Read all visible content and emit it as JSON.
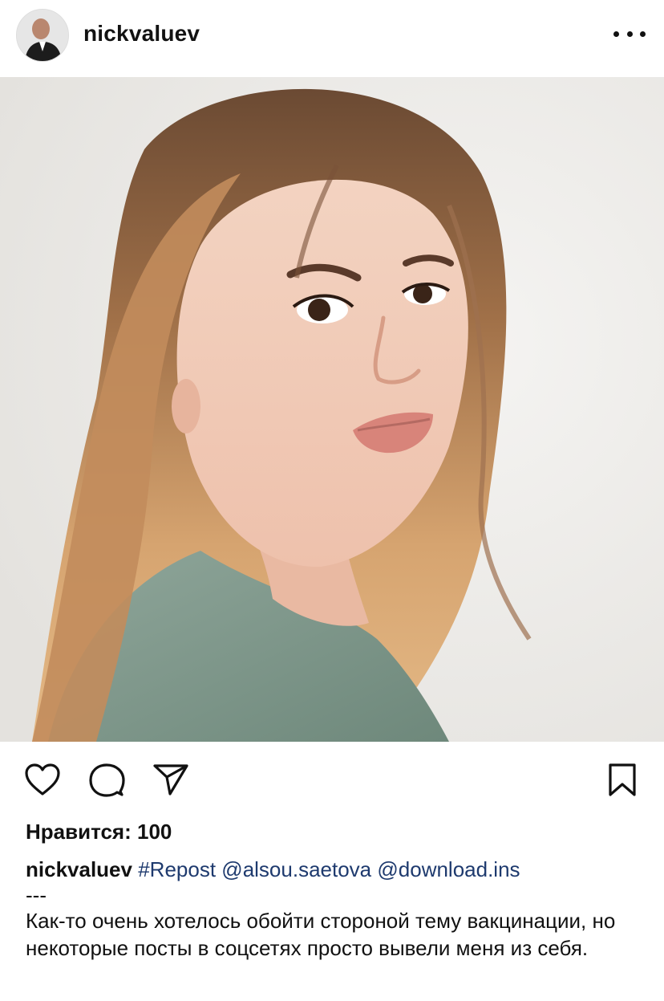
{
  "header": {
    "username": "nickvaluev",
    "more_icon": "more-horizontal-icon"
  },
  "post": {
    "image_alt": "Portrait of a woman with long ombré hair in a sage-green top"
  },
  "actions": {
    "like_icon": "heart-icon",
    "comment_icon": "comment-icon",
    "share_icon": "send-icon",
    "save_icon": "bookmark-icon"
  },
  "likes": {
    "text": "Нравится: 100"
  },
  "caption": {
    "username": "nickvaluev",
    "hashtag": "#Repost",
    "mention1": "@alsou.saetova",
    "mention2": "@download.ins",
    "separator": "---",
    "text": "Как-то очень хотелось обойти стороной тему вакцинации, но некоторые посты в соцсетях просто вывели меня из себя."
  },
  "colors": {
    "link": "#1e3a6e",
    "text": "#111111",
    "background": "#ffffff"
  }
}
